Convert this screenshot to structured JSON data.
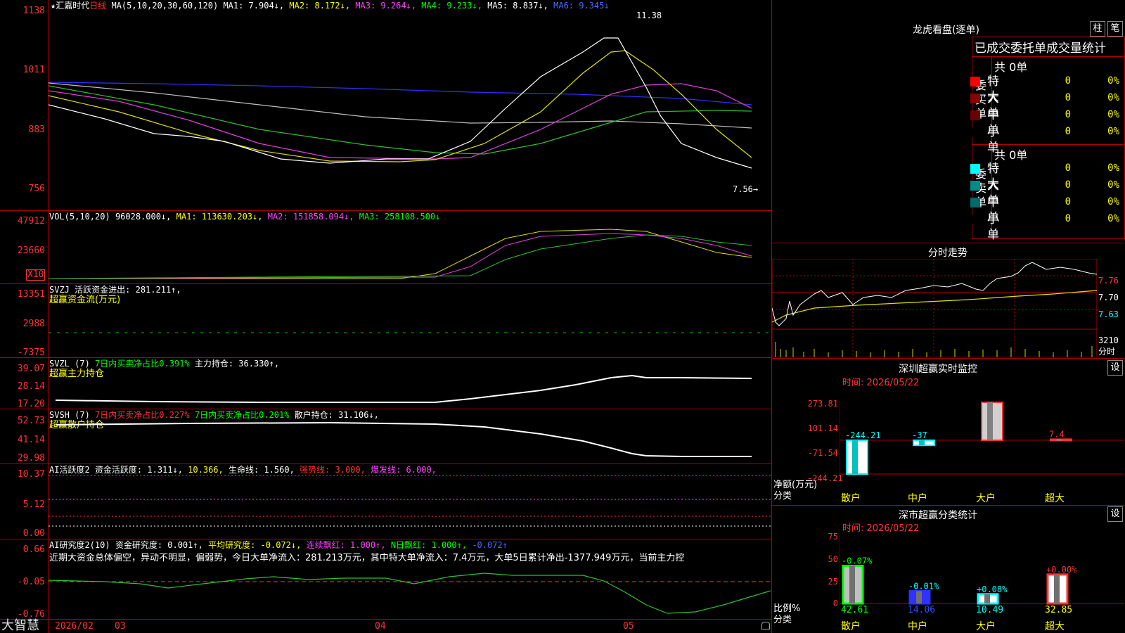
{
  "app": {
    "brand": "大智慧",
    "stock_title": "★汇嘉时代",
    "period_label": "日线",
    "ma_params": "MA(5,10,20,30,60,120)",
    "ma1": "MA1: 7.904↓,",
    "ma2": "MA2: 8.172↓,",
    "ma3": "MA3: 9.264↓,",
    "ma4": "MA4: 9.233↓,",
    "ma5": "MA5: 8.837↓,",
    "ma6": "MA6: 9.345↓",
    "high_mark": "11.38",
    "low_mark": "7.56→",
    "main_y_ticks": [
      "1138",
      "1011",
      "883",
      "756"
    ]
  },
  "vol_panel": {
    "header": "VOL(5,10,20)",
    "vol_val": "96028.000↓,",
    "ma1": "MA1: 113630.203↓,",
    "ma2": "MA2: 151858.094↓,",
    "ma3": "MA3: 258108.500↓",
    "y_ticks": [
      "47912",
      "23660"
    ],
    "multiplier": "X10"
  },
  "svzj_panel": {
    "header": "SVZJ",
    "item1": "活跃资金进出: 281.211↑,",
    "sub": "超赢资金流(万元)",
    "y_ticks": [
      "13351",
      "2988",
      "-7375"
    ]
  },
  "svzl_panel": {
    "header": "SVZL (7)",
    "item1": "7日内买卖净占比0.391%",
    "item2": "主力持仓: 36.330↑,",
    "sub": "超赢主力持仓",
    "y_ticks": [
      "39.07",
      "28.14",
      "17.20"
    ]
  },
  "svsh_panel": {
    "header": "SVSH (7)",
    "item1": "7日内买卖净占比0.227%",
    "item2": "7日内买卖净占比0.201%",
    "item3": "散户持仓: 31.106↓,",
    "sub": "超赢散户持仓",
    "y_ticks": [
      "52.73",
      "41.14",
      "29.98"
    ]
  },
  "ai_active_panel": {
    "header": "AI活跃度2",
    "item1": "资金活跃度: 1.311↓,",
    "item2": "10.366,",
    "item3": "生命线: 1.560,",
    "item4": "强势线: 3.000,",
    "item5": "爆发线: 6.000,",
    "y_ticks": [
      "10.37",
      "5.12",
      "0.00"
    ]
  },
  "ai_research_panel": {
    "header": "AI研究度2(10)",
    "item1": "资金研究度: 0.001↑,",
    "item2": "平均研究度: -0.072↓,",
    "item3": "连续飘红: 1.000↑,",
    "item4": "N日飘红: 1.000↑,",
    "item5": "-0.072↑",
    "comment": "近期大资金总体偏空，异动不明显，偏弱势，今日大单净流入：281.213万元，其中特大单净流入：7.4万元，大单5日累计净出-1377.949万元，当前主力控",
    "y_ticks": [
      "0.66",
      "-0.05",
      "-0.76"
    ]
  },
  "x_axis": {
    "labels": [
      "2026/02",
      "03",
      "04",
      "05"
    ]
  },
  "dragon": {
    "title": "龙虎看盘(逐单)",
    "btn_bar": "柱",
    "btn_list": "笔",
    "header": "已成交委托单成交量统计",
    "buy_group": "委买单",
    "sell_group": "委卖单",
    "buy_total": "共 0单",
    "sell_total": "共 0单",
    "buy_rows": [
      {
        "label": "特大",
        "val": "0",
        "pct": "0%",
        "color": "#ff0000"
      },
      {
        "label": "大单",
        "val": "0",
        "pct": "0%",
        "color": "#8b0000"
      },
      {
        "label": "中单",
        "val": "0",
        "pct": "0%",
        "color": "#6b0000"
      },
      {
        "label": "小单",
        "val": "0",
        "pct": "0%",
        "color": "#000000"
      }
    ],
    "sell_rows": [
      {
        "label": "特大",
        "val": "0",
        "pct": "0%",
        "color": "#00ffff"
      },
      {
        "label": "大单",
        "val": "0",
        "pct": "0%",
        "color": "#008b8b"
      },
      {
        "label": "中单",
        "val": "0",
        "pct": "0%",
        "color": "#006b6b"
      },
      {
        "label": "小单",
        "val": "0",
        "pct": "0%",
        "color": "#000000"
      }
    ]
  },
  "intraday": {
    "title": "分时走势",
    "y_ticks": [
      "7.76",
      "7.70",
      "7.63"
    ],
    "vol_tick": "3210",
    "vol_label": "分时"
  },
  "monitor": {
    "title": "深圳超赢实时监控",
    "settings": "设",
    "time": "时间: 2026/05/22",
    "y_ticks": [
      "273.81",
      "101.14",
      "-71.54",
      "-244.21"
    ],
    "y_label": "净额(万元)",
    "x_label": "分类",
    "categories": [
      "散户",
      "中户",
      "大户",
      "超大"
    ],
    "values": [
      "-244.21",
      "-37",
      "273.81",
      "7.4"
    ],
    "value_nums": [
      -244.21,
      -37,
      273.81,
      7.4
    ]
  },
  "classify": {
    "title": "深市超赢分类统计",
    "settings": "设",
    "time": "时间: 2026/05/22",
    "y_ticks": [
      "75",
      "50",
      "25",
      "0"
    ],
    "y_label": "比例%",
    "x_label": "分类",
    "categories": [
      "散户",
      "中户",
      "大户",
      "超大"
    ],
    "top_labels": [
      "-0.07%",
      "-0.01%",
      "+0.08%",
      "+0.00%"
    ],
    "bottom_values": [
      "42.61",
      "14.06",
      "10.49",
      "32.85"
    ],
    "value_nums": [
      42.61,
      14.06,
      10.49,
      32.85
    ]
  }
}
